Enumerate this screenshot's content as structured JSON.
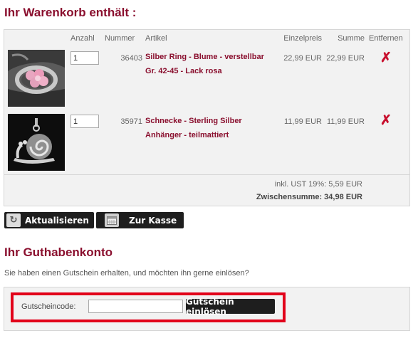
{
  "cart": {
    "title": "Ihr Warenkorb enthält :",
    "columns": {
      "anzahl": "Anzahl",
      "nummer": "Nummer",
      "artikel": "Artikel",
      "einzelpreis": "Einzelpreis",
      "summe": "Summe",
      "entfernen": "Entfernen"
    },
    "items": [
      {
        "image": "silver-ring-flower-photo",
        "quantity": "1",
        "number": "36403",
        "name_line1": "Silber Ring - Blume - verstellbar",
        "name_line2": "Gr. 42-45 - Lack rosa",
        "unit_price": "22,99 EUR",
        "sum": "22,99 EUR",
        "remove_icon": "remove-x-icon"
      },
      {
        "image": "snail-pendant-photo",
        "quantity": "1",
        "number": "35971",
        "name_line1": "Schnecke - Sterling Silber",
        "name_line2": "Anhänger - teilmattiert",
        "unit_price": "11,99 EUR",
        "sum": "11,99 EUR",
        "remove_icon": "remove-x-icon"
      }
    ],
    "tax": "inkl. UST 19%: 5,59 EUR",
    "subtotal": "Zwischensumme: 34,98 EUR"
  },
  "actions": {
    "update_label": "Aktualisieren",
    "update_icon": "refresh-icon",
    "checkout_label": "Zur Kasse",
    "checkout_icon": "calendar-icon"
  },
  "voucher": {
    "title": "Ihr Guthabenkonto",
    "info": "Sie haben einen Gutschein erhalten, und möchten ihn gerne einlösen?",
    "code_label": "Gutscheincode:",
    "code_value": "",
    "redeem_label": "Gutschein einlösen"
  },
  "colors": {
    "brand": "#8a0f2e",
    "remove": "#c8102e",
    "highlight": "#e2001a",
    "button": "#1e1e1e"
  }
}
